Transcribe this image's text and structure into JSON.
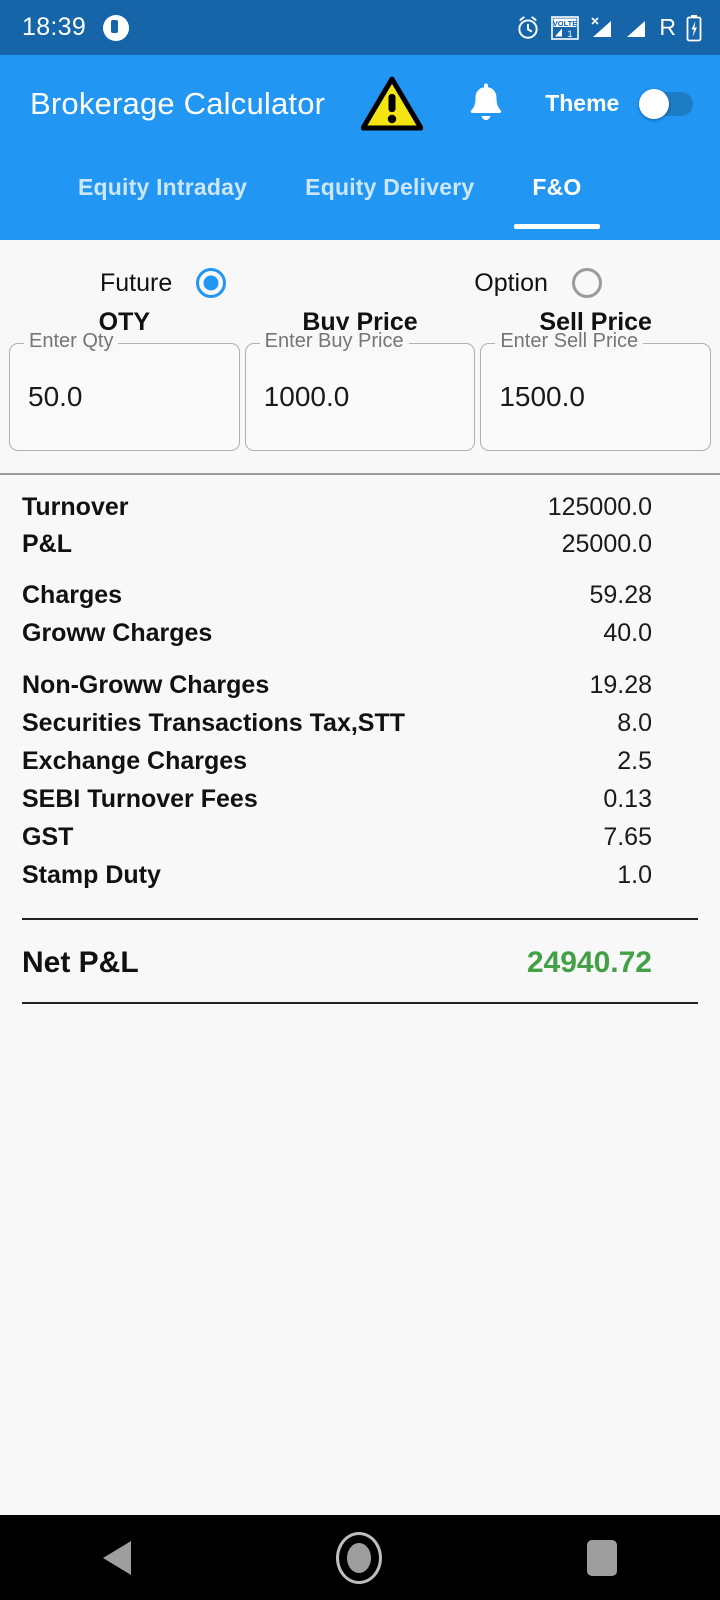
{
  "statusbar": {
    "time": "18:39",
    "notification_icon": "app-notification-icon",
    "icons": [
      "alarm-icon",
      "volte-icon",
      "signal-no-service-icon",
      "signal-icon",
      "roaming-icon",
      "battery-charging-icon"
    ],
    "volte_label": "VOLTE",
    "volte_sim": "1",
    "roaming_label": "R"
  },
  "appbar": {
    "title": "Brokerage Calculator",
    "warning_icon": "warning-triangle-icon",
    "bell_icon": "bell-icon",
    "theme_label": "Theme",
    "theme_switch_on": false,
    "background_color": "#2196f3"
  },
  "tabs": [
    {
      "label": "Equity Intraday",
      "active": false
    },
    {
      "label": "Equity Delivery",
      "active": false
    },
    {
      "label": "F&O",
      "active": true
    }
  ],
  "segment": {
    "future_label": "Future",
    "future_selected": true,
    "option_label": "Option",
    "option_selected": false
  },
  "inputs": [
    {
      "header": "QTY",
      "placeholder": "Enter Qty",
      "value": "50.0"
    },
    {
      "header": "Buy Price",
      "placeholder": "Enter Buy Price",
      "value": "1000.0"
    },
    {
      "header": "Sell Price",
      "placeholder": "Enter Sell Price",
      "value": "1500.0"
    }
  ],
  "summary": {
    "group1": [
      {
        "label": "Turnover",
        "value": "125000.0"
      },
      {
        "label": "P&L",
        "value": "25000.0"
      }
    ],
    "group2": [
      {
        "label": "Charges",
        "value": "59.28"
      },
      {
        "label": "Groww Charges",
        "value": "40.0"
      }
    ],
    "group3": [
      {
        "label": "Non-Groww Charges",
        "value": "19.28"
      },
      {
        "label": "Securities Transactions Tax,STT",
        "value": "8.0"
      },
      {
        "label": "Exchange Charges",
        "value": "2.5"
      },
      {
        "label": "SEBI Turnover Fees",
        "value": "0.13"
      },
      {
        "label": "GST",
        "value": "7.65"
      },
      {
        "label": "Stamp Duty",
        "value": "1.0"
      }
    ],
    "net": {
      "label": "Net P&L",
      "value": "24940.72",
      "value_color": "#43a047"
    }
  },
  "navbar": {
    "back": "back-icon",
    "home": "home-icon",
    "recents": "recents-icon"
  }
}
